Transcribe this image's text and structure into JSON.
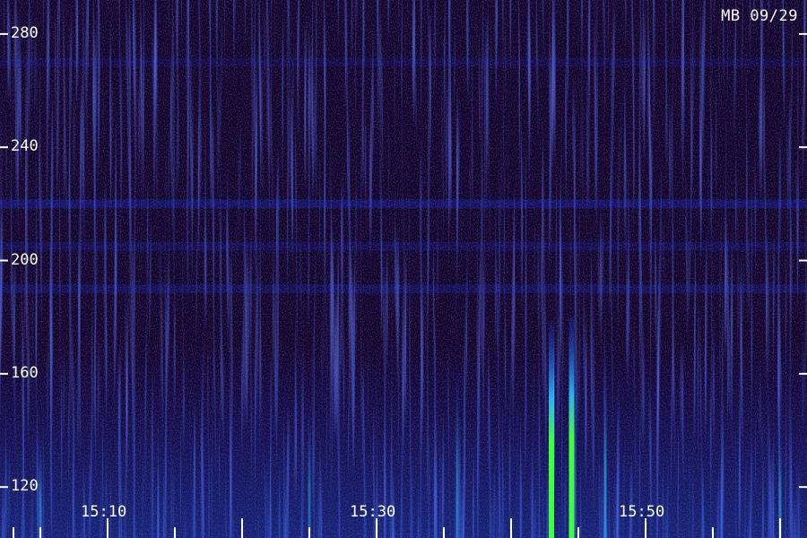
{
  "header": {
    "badge": "MB 09/29"
  },
  "chart_data": {
    "type": "heatmap",
    "title": "",
    "xlabel": "",
    "ylabel": "",
    "ylim": [
      102,
      292
    ],
    "y_ticks": [
      120,
      160,
      200,
      240,
      280
    ],
    "y_tick_labels": [
      "120",
      "160",
      "200",
      "240",
      "280"
    ],
    "x_range": [
      "15:02",
      "16:02"
    ],
    "x_ticks": [
      "15:10",
      "15:30",
      "15:50"
    ],
    "x_tick_labels": [
      "15:10",
      "15:30",
      "15:50"
    ],
    "x_minor_ticks": [
      "15:03",
      "15:05",
      "15:10",
      "15:15",
      "15:20",
      "15:25",
      "15:30",
      "15:35",
      "15:40",
      "15:45",
      "15:50",
      "15:55",
      "16:00"
    ],
    "grid": false,
    "colormap": [
      "#0a0018",
      "#2a0a8a",
      "#2040ff",
      "#30c0ff",
      "#40ff40"
    ],
    "background_color": "#0a0018",
    "bright_features": [
      {
        "time": "15:43",
        "y_from": 102,
        "y_to": 178,
        "intensity": 1.0
      },
      {
        "time": "15:44.5",
        "y_from": 102,
        "y_to": 180,
        "intensity": 1.0
      },
      {
        "time": "15:47",
        "y_from": 102,
        "y_to": 168,
        "intensity": 0.55
      },
      {
        "time": "15:36",
        "y_from": 102,
        "y_to": 165,
        "intensity": 0.45
      },
      {
        "time": "15:25",
        "y_from": 102,
        "y_to": 150,
        "intensity": 0.4
      },
      {
        "time": "15:05",
        "y_from": 102,
        "y_to": 140,
        "intensity": 0.4
      },
      {
        "time": "16:00",
        "y_from": 102,
        "y_to": 145,
        "intensity": 0.45
      }
    ],
    "horizontal_bands": [
      {
        "y": 220,
        "intensity": 0.55
      },
      {
        "y": 205,
        "intensity": 0.35
      },
      {
        "y": 190,
        "intensity": 0.4
      },
      {
        "y": 270,
        "intensity": 0.25
      }
    ]
  }
}
